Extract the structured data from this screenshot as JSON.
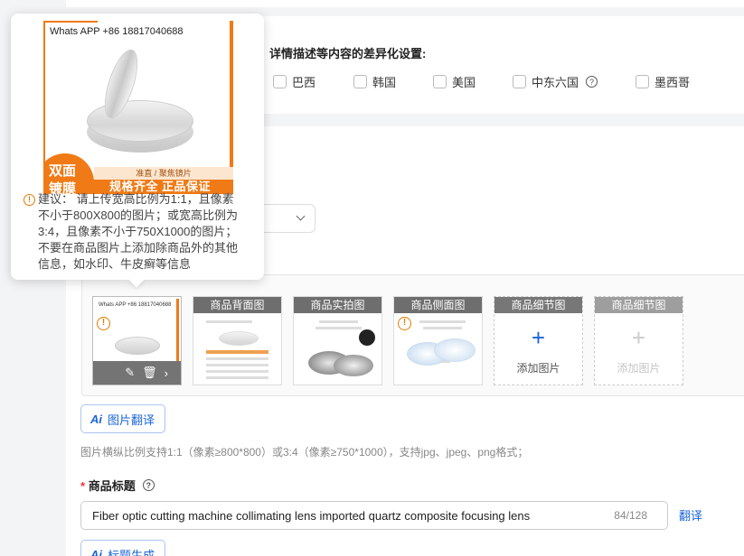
{
  "differentiation": {
    "title": "详情描述等内容的差异化设置:",
    "countries": [
      {
        "label": "巴西",
        "has_help": false
      },
      {
        "label": "韩国",
        "has_help": false
      },
      {
        "label": "美国",
        "has_help": false
      },
      {
        "label": "中东六国",
        "has_help": true
      },
      {
        "label": "墨西哥",
        "has_help": false
      }
    ]
  },
  "popover": {
    "whatsapp": "Whats APP +86 18817040688",
    "badge_line1": "双面",
    "badge_line2": "镀膜",
    "tag_band": "准直 / 聚焦镜片",
    "bottom_band": "规格齐全  正品保证",
    "suggestion_lines": [
      "建议： 请上传宽高比例为1:1，且像素",
      "不小于800X800的图片；或宽高比例为",
      "3:4，且像素不小于750X1000的图片；",
      "不要在商品图片上添加除商品外的其他",
      "信息，如水印、牛皮癣等信息"
    ]
  },
  "images": {
    "slots": [
      {
        "caption": "",
        "type": "main"
      },
      {
        "caption": "商品背面图",
        "type": "filled"
      },
      {
        "caption": "商品实拍图",
        "type": "filled"
      },
      {
        "caption": "商品侧面图",
        "type": "filled"
      },
      {
        "caption": "商品细节图",
        "type": "add"
      },
      {
        "caption": "商品细节图",
        "type": "add-disabled"
      }
    ],
    "main_thumb_text": "Whats APP +86 18817040688",
    "add_label": "添加图片",
    "translate_button": "图片翻译",
    "ai_label": "Ai",
    "format_hint": "图片横纵比例支持1:1（像素≥800*800）或3:4（像素≥750*1000），支持jpg、jpeg、png格式；"
  },
  "product_title": {
    "required_mark": "*",
    "label": "商品标题",
    "value": "Fiber optic cutting machine collimating lens imported quartz composite focusing lens",
    "char_count": "84/128",
    "translate_link": "翻译",
    "generate_button": "标题生成"
  }
}
